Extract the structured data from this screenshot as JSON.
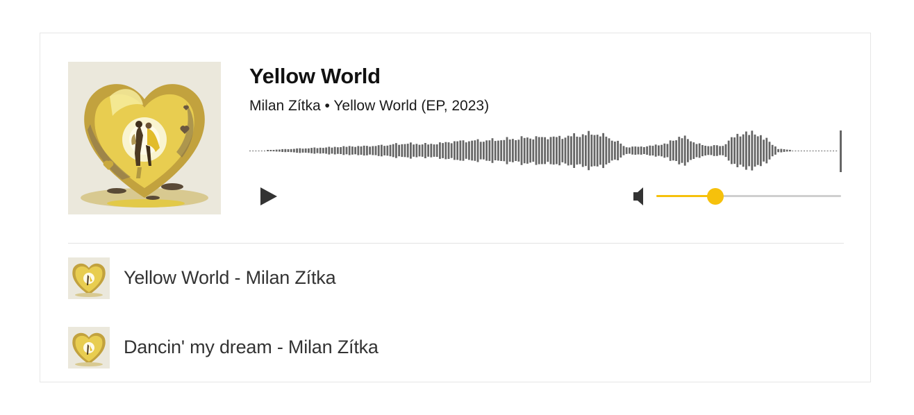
{
  "player": {
    "title": "Yellow World",
    "subtitle": "Milan Zítka • Yellow World (EP, 2023)",
    "cover_icon": "album-art-heart-couple",
    "play_icon": "play",
    "volume_icon": "speaker",
    "volume": 0.32,
    "colors": {
      "accent": "#f6c10c",
      "waveform": "#666666",
      "track_bg": "#cfcfcf"
    }
  },
  "playlist": [
    {
      "label": "Yellow World - Milan Zítka",
      "thumb_icon": "album-art-heart-couple"
    },
    {
      "label": "Dancin' my dream - Milan Zítka",
      "thumb_icon": "album-art-heart-couple"
    }
  ]
}
